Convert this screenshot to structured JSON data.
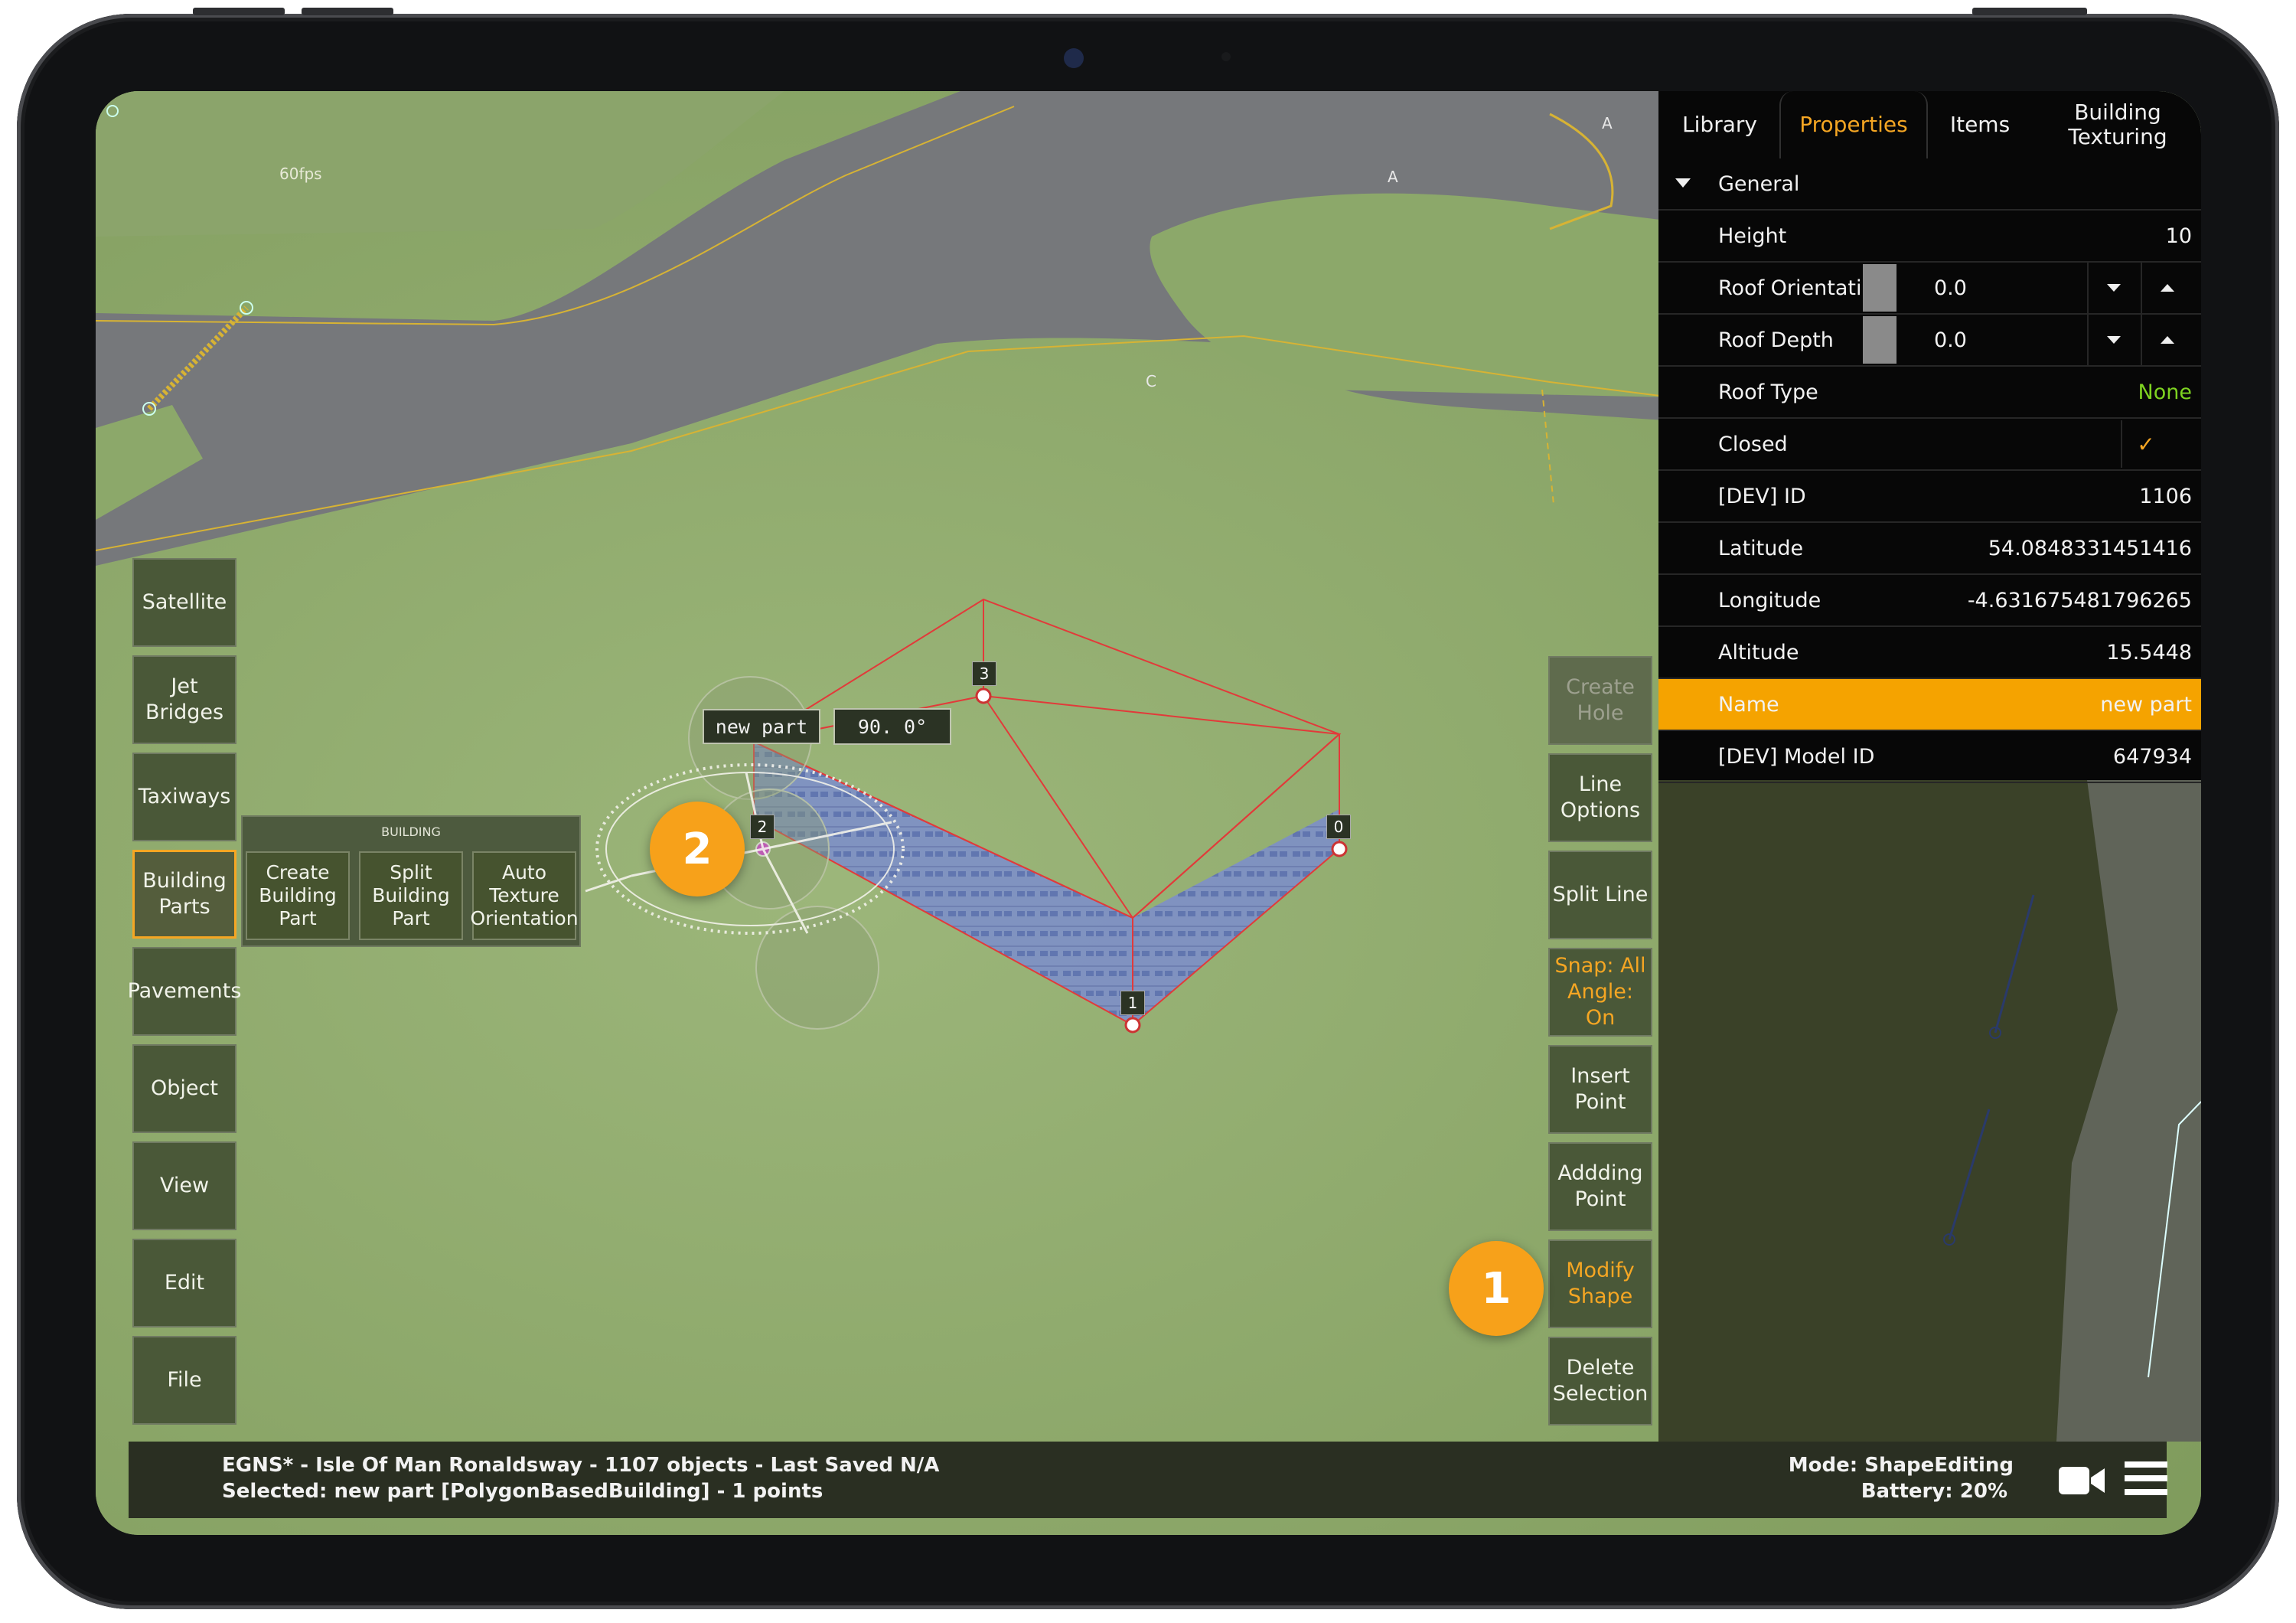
{
  "fps": "60fps",
  "map_labels": {
    "a1": "A",
    "a2": "A",
    "c": "C"
  },
  "left_toolbar": [
    {
      "label": "Satellite"
    },
    {
      "label": "Jet Bridges"
    },
    {
      "label": "Taxiways"
    },
    {
      "label": "Building Parts",
      "active": true
    },
    {
      "label": "Pavements"
    },
    {
      "label": "Object"
    },
    {
      "label": "View"
    },
    {
      "label": "Edit"
    },
    {
      "label": "File"
    }
  ],
  "building_panel": {
    "title": "BUILDING",
    "buttons": [
      {
        "label": "Create Building Part"
      },
      {
        "label": "Split Building Part"
      },
      {
        "label": "Auto Texture Orientation"
      }
    ]
  },
  "right_toolbar": [
    {
      "label": "Create Hole",
      "state": "disabled"
    },
    {
      "label": "Line Options"
    },
    {
      "label": "Split Line"
    },
    {
      "label": "Snap: All Angle: On",
      "state": "highlight"
    },
    {
      "label": "Insert Point"
    },
    {
      "label": "Addding Point"
    },
    {
      "label": "Modify Shape",
      "state": "highlight"
    },
    {
      "label": "Delete Selection"
    }
  ],
  "tabs": [
    {
      "label": "Library"
    },
    {
      "label": "Properties",
      "active": true
    },
    {
      "label": "Items"
    },
    {
      "label": "Building Texturing"
    }
  ],
  "properties": {
    "section": "General",
    "height": {
      "label": "Height",
      "value": "10"
    },
    "roof_orientation": {
      "label": "Roof Orientation",
      "value": "0.0"
    },
    "roof_depth": {
      "label": "Roof Depth",
      "value": "0.0"
    },
    "roof_type": {
      "label": "Roof Type",
      "value": "None"
    },
    "closed": {
      "label": "Closed",
      "checked": true
    },
    "dev_id": {
      "label": "[DEV] ID",
      "value": "1106"
    },
    "latitude": {
      "label": "Latitude",
      "value": "54.0848331451416"
    },
    "longitude": {
      "label": "Longitude",
      "value": "-4.631675481796265"
    },
    "altitude": {
      "label": "Altitude",
      "value": "15.5448"
    },
    "name": {
      "label": "Name",
      "value": "new part"
    },
    "dev_model_id": {
      "label": "[DEV] Model ID",
      "value": "647934"
    }
  },
  "gizmo": {
    "name_tag": "new part",
    "angle_tag": "90. 0°"
  },
  "vertices": [
    "0",
    "1",
    "2",
    "3"
  ],
  "callouts": {
    "one": "1",
    "two": "2"
  },
  "status": {
    "line1": "EGNS* - Isle Of Man Ronaldsway - 1107 objects - Last Saved N/A",
    "line2": "Selected: new part [PolygonBasedBuilding] - 1 points",
    "mode": "Mode: ShapeEditing",
    "battery": "Battery: 20%"
  },
  "colors": {
    "accent": "#f5a623",
    "roof_type_value": "#7ed321",
    "highlight_row": "#f5a300"
  }
}
